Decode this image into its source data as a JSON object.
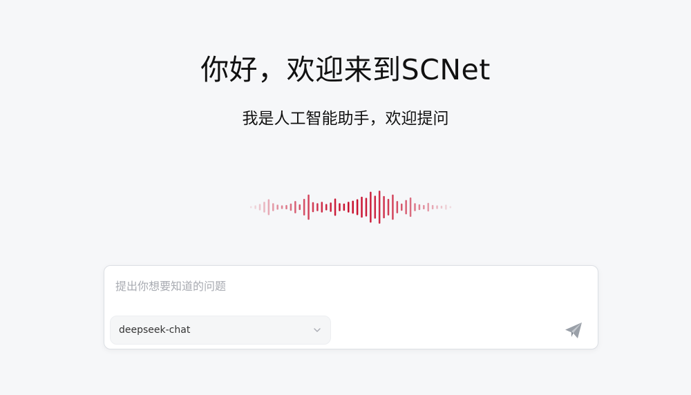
{
  "header": {
    "title": "你好，欢迎来到SCNet",
    "subtitle": "我是人工智能助手，欢迎提问"
  },
  "chat": {
    "input_placeholder": "提出你想要知道的问题",
    "input_value": "",
    "model": {
      "selected": "deepseek-chat"
    },
    "send_icon": "paper-plane-icon",
    "dropdown_icon": "chevron-down-icon"
  },
  "voice_wave": {
    "icon": "sound-wave-icon",
    "accent_color": "#c8102e",
    "levels": [
      0.06,
      0.1,
      0.18,
      0.3,
      0.44,
      0.22,
      0.14,
      0.1,
      0.12,
      0.2,
      0.34,
      0.16,
      0.46,
      0.7,
      0.28,
      0.22,
      0.3,
      0.18,
      0.26,
      0.48,
      0.22,
      0.2,
      0.3,
      0.36,
      0.44,
      0.58,
      0.52,
      0.86,
      0.64,
      0.92,
      0.62,
      0.46,
      0.7,
      0.34,
      0.2,
      0.4,
      0.54,
      0.22,
      0.16,
      0.12,
      0.24,
      0.12,
      0.1,
      0.08,
      0.14,
      0.06
    ]
  },
  "colors": {
    "background": "#f6f7f9",
    "text": "#111111",
    "placeholder": "#a8abb2",
    "send_icon": "#9aa0a8"
  }
}
